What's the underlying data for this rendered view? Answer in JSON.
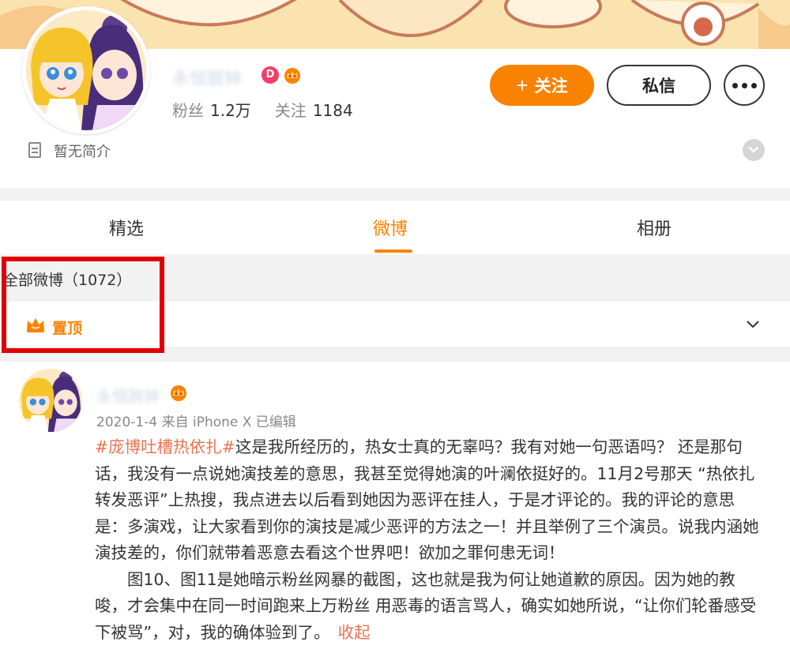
{
  "profile": {
    "username": "永恒脱钟",
    "fans_label": "粉丝",
    "fans_count": "1.2万",
    "following_label": "关注",
    "following_count": "1184",
    "bio": "暂无简介",
    "follow_button": "关注",
    "message_button": "私信"
  },
  "tabs": [
    {
      "label": "精选"
    },
    {
      "label": "微博"
    },
    {
      "label": "相册"
    }
  ],
  "feed": {
    "all_count": "全部微博（1072）",
    "pinned_label": "置顶"
  },
  "post": {
    "username": "永恒脱钟",
    "meta": "2020-1-4  来自 iPhone X 已编辑",
    "hashtag": "#庞博吐槽热依扎#",
    "paragraph1": "这是我所经历的，热女士真的无辜吗？我有对她一句恶语吗？ 还是那句话，我没有一点说她演技差的意思，我甚至觉得她演的叶澜依挺好的。11月2号那天 “热依扎转发恶评”上热搜，我点进去以后看到她因为恶评在挂人，于是才评论的。我的评论的意思是：多演戏，让大家看到你的演技是减少恶评的方法之一！并且举例了三个演员。说我内涵她演技差的，你们就带着恶意去看这个世界吧！欲加之罪何患无词！",
    "paragraph2": "图10、图11是她暗示粉丝网暴的截图，这也就是我为何让她道歉的原因。因为她的教唆，才会集中在同一时间跑来上万粉丝 用恶毒的语言骂人，确实如她所说，“让你们轮番感受下被骂”，对，我的确体验到了。",
    "collapse_link": "收起"
  },
  "colors": {
    "accent": "#f98200",
    "hashtag": "#eb7350",
    "highlight_box": "#e00000",
    "banner": "#fbe3b0"
  }
}
